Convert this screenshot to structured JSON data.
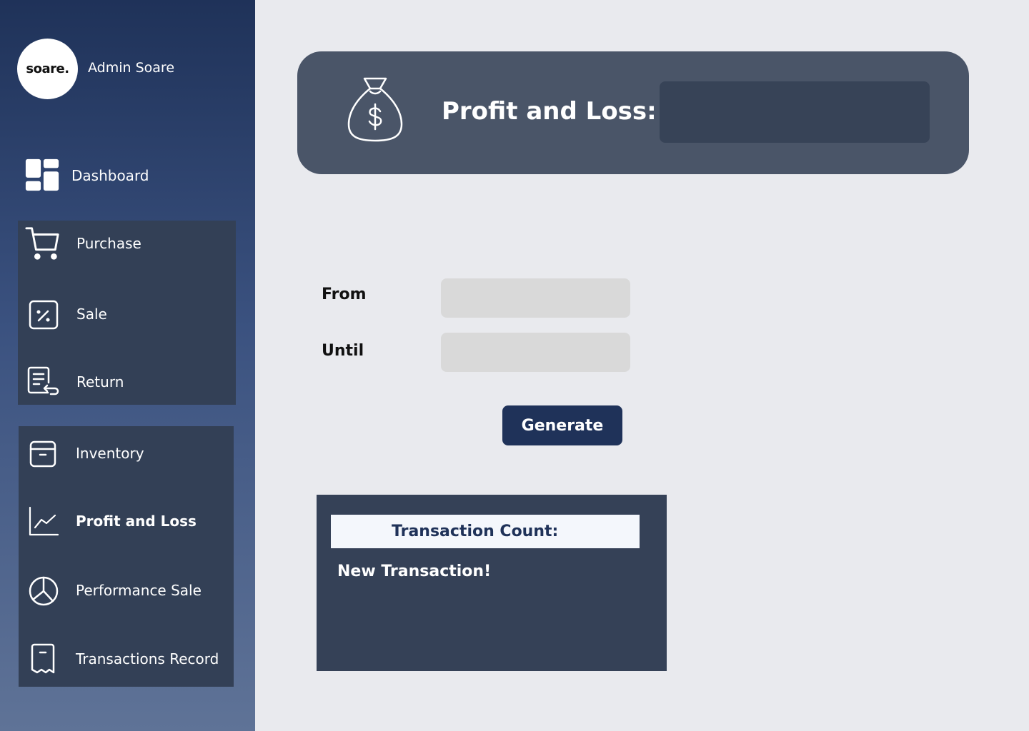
{
  "sidebar": {
    "logo_text": "soare.",
    "admin_name": "Admin Soare",
    "items": [
      {
        "label": "Dashboard",
        "icon": "dashboard-icon"
      },
      {
        "label": "Purchase",
        "icon": "cart-icon"
      },
      {
        "label": "Sale",
        "icon": "sale-icon"
      },
      {
        "label": "Return",
        "icon": "return-icon"
      },
      {
        "label": "Inventory",
        "icon": "inventory-icon"
      },
      {
        "label": "Profit and Loss",
        "icon": "chart-line-icon",
        "active": true
      },
      {
        "label": "Performance Sale",
        "icon": "pie-chart-icon"
      },
      {
        "label": "Transactions Record",
        "icon": "receipt-icon"
      }
    ]
  },
  "header": {
    "title": "Profit and Loss:",
    "value": "",
    "icon": "money-bag-icon"
  },
  "form": {
    "from_label": "From",
    "from_value": "",
    "until_label": "Until",
    "until_value": "",
    "generate_label": "Generate"
  },
  "transactions": {
    "count_label": "Transaction Count:",
    "new_label": "New Transaction!"
  },
  "colors": {
    "sidebar_top": "#1f3259",
    "sidebar_bottom": "#5f7397",
    "panel": "#334056",
    "header_card": "#4a5568",
    "button": "#1f3259",
    "background": "#e9eaee"
  }
}
